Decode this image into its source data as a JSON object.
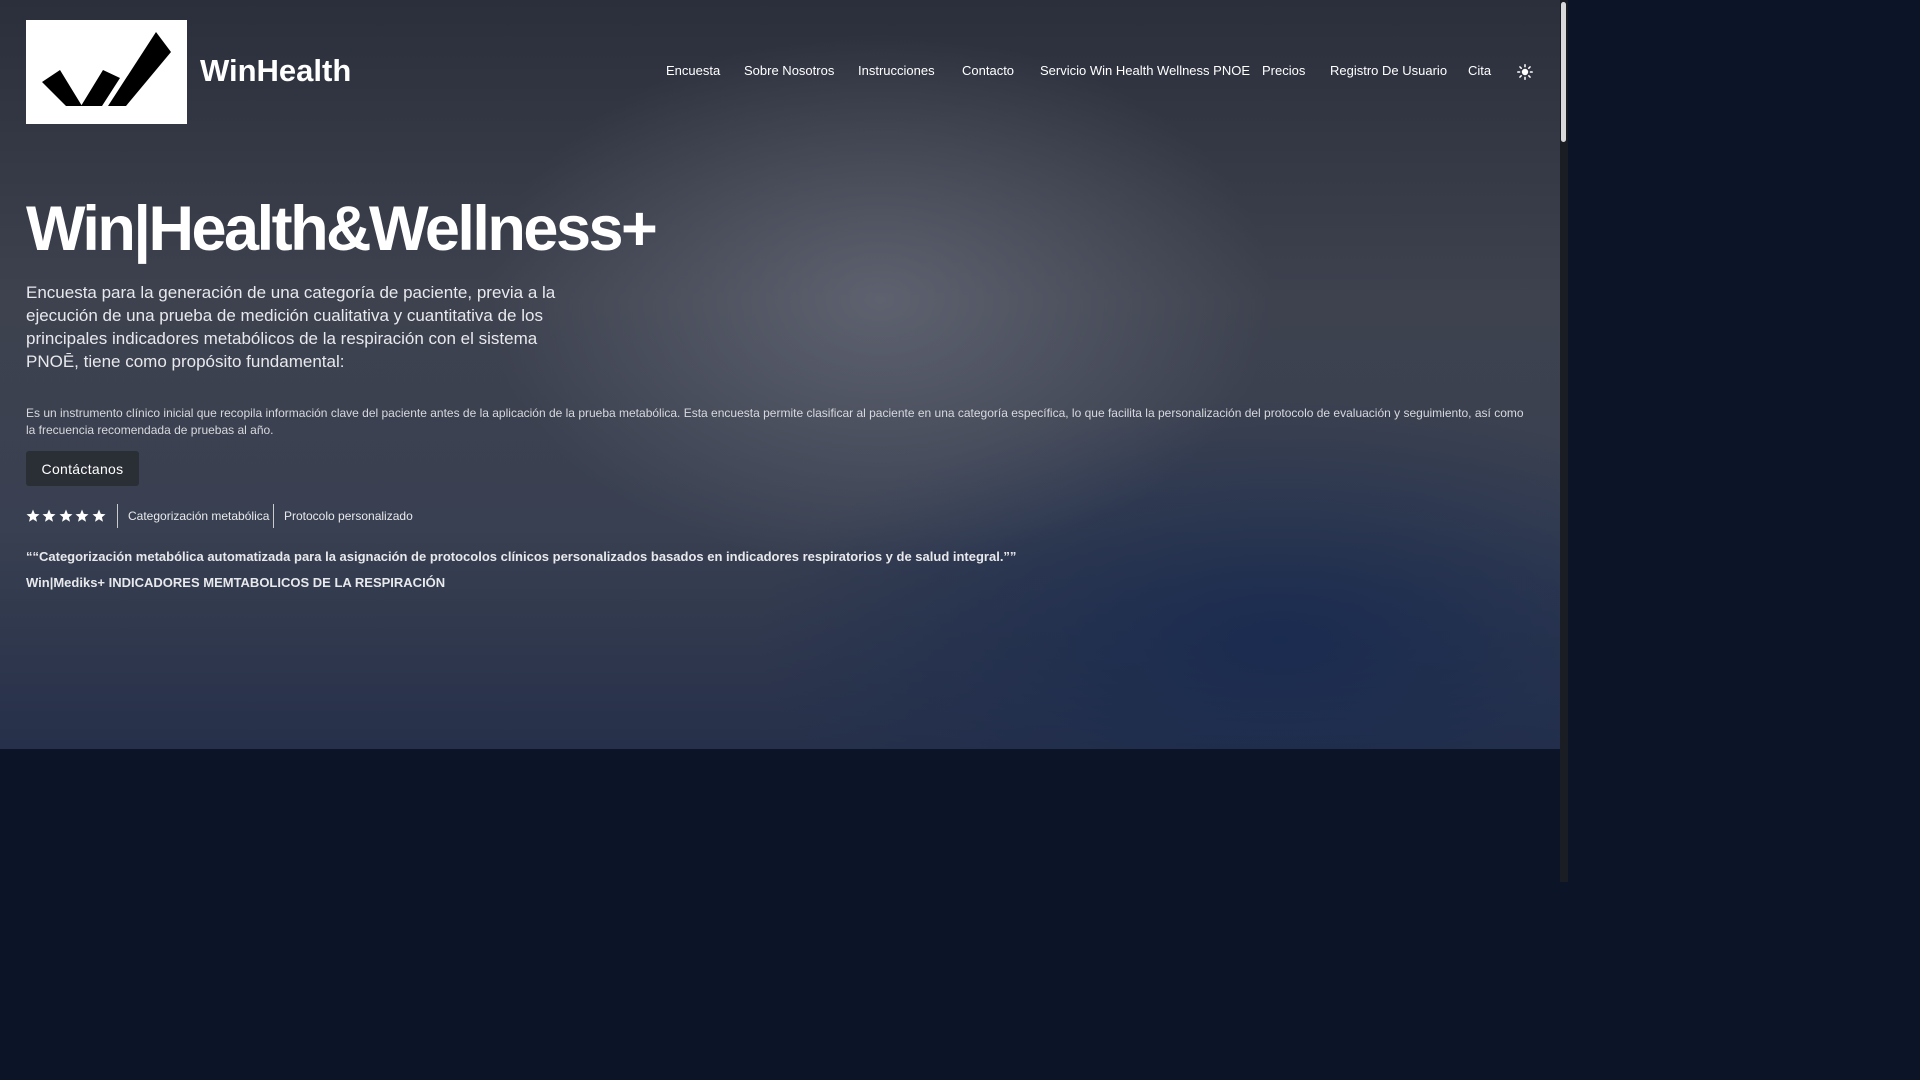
{
  "header": {
    "logo_alt": "WinHealth logo",
    "brand": "WinHealth"
  },
  "nav": {
    "items": [
      "Encuesta",
      "Sobre Nosotros",
      "Instrucciones",
      "Contacto",
      "Servicio Win Health Wellness PNOE",
      "Precios",
      "Registro De Usuario",
      "Cita"
    ],
    "theme_toggle_icon": "sun-icon"
  },
  "hero": {
    "title": "Win|Health&Wellness+",
    "lead": "Encuesta para la generación de una categoría de paciente, previa a la ejecución de una prueba de medición cualitativa y cuantitativa de los principales indicadores metabólicos de la respiración con el sistema PNOĒ, tiene como propósito fundamental:",
    "description": "Es un instrumento clínico inicial que recopila información clave del paciente antes de la aplicación de la prueba metabólica. Esta encuesta permite clasificar al paciente en una categoría específica, lo que facilita la personalización del protocolo de evaluación y seguimiento, así como la frecuencia recomendada de pruebas al año.",
    "cta": "Contáctanos",
    "rating": 5,
    "tags": [
      "Categorización metabólica",
      "Protocolo personalizado"
    ],
    "quote": "““Categorización metabólica automatizada para la asignación de protocolos clínicos personalizados basados en indicadores respiratorios y de salud integral.””",
    "subtitle": "Win|Mediks+ INDICADORES MEMTABOLICOS DE LA RESPIRACIÓN"
  },
  "colors": {
    "background_dark": "#0c1427",
    "button": "#2a2e35",
    "text": "#ffffff"
  }
}
